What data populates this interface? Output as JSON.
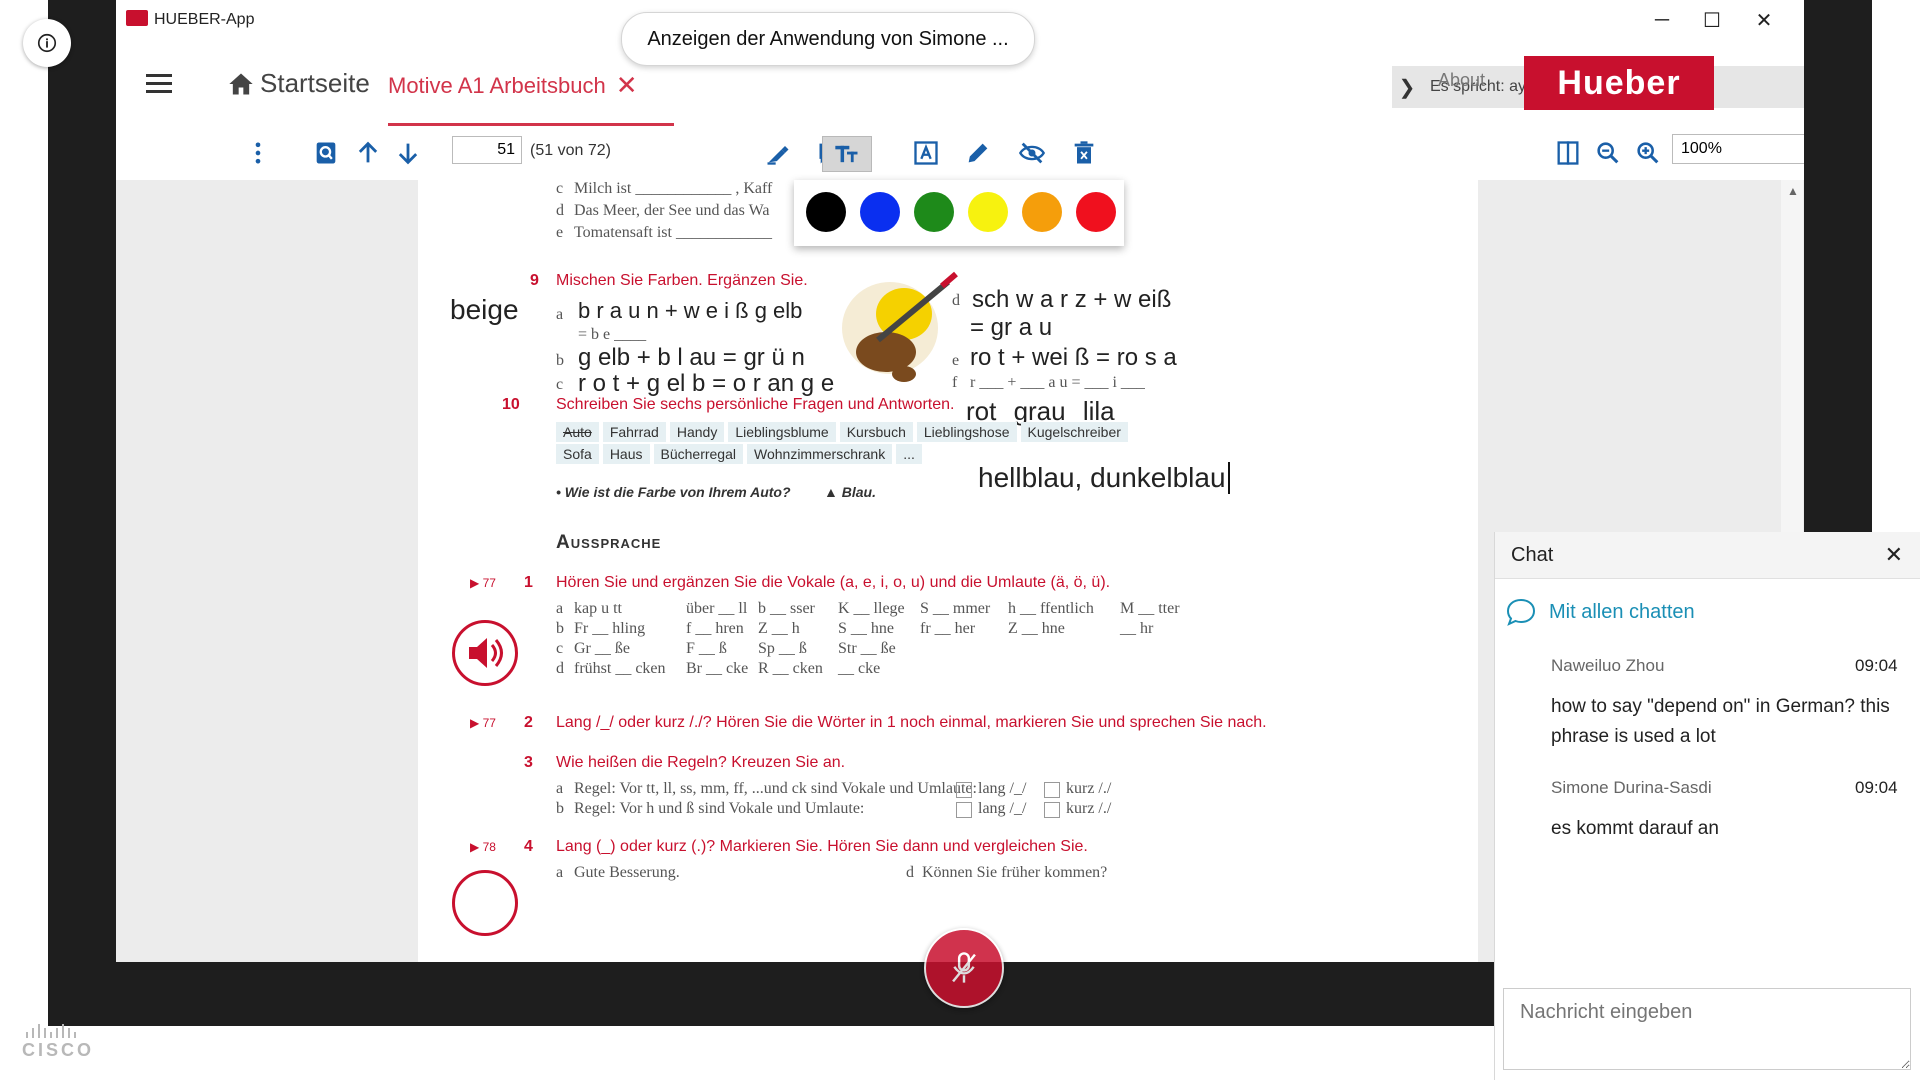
{
  "app": {
    "title": "HUEBER-App",
    "share_banner": "Anzeigen der Anwendung von Simone ..."
  },
  "window_controls": {
    "minimize": "─",
    "maximize": "☐",
    "close": "✕"
  },
  "nav": {
    "home_label": "Startseite",
    "book_tab": "Motive A1 Arbeitsbuch",
    "speaker_status": "Es spricht: ayse",
    "about": "About",
    "brand": "Hueber"
  },
  "toolbar": {
    "page_value": "51",
    "page_count": "(51 von 72)",
    "zoom_value": "100%"
  },
  "palette": {
    "colors": [
      "#000000",
      "#0a2ff0",
      "#1e8a1a",
      "#f7f20f",
      "#f59e0b",
      "#f0101e"
    ]
  },
  "doc": {
    "top_lines": [
      {
        "letter": "c",
        "text": "Milch ist ____________ , Kaff"
      },
      {
        "letter": "d",
        "text": "Das Meer, der See und das Wa"
      },
      {
        "letter": "e",
        "text": "Tomatensaft ist ____________"
      }
    ],
    "task9": {
      "num": "9",
      "title": "Mischen Sie Farben. Ergänzen Sie.",
      "beige": "beige",
      "a_letter": "a",
      "a_text": "b r a u n + w e i ß g elb",
      "a_result": "= b e ____",
      "b_letter": "b",
      "b_text": "g elb + b l au = gr ü n",
      "c_letter": "c",
      "c_text": "r o t + g el b = o r an g e",
      "d_letter": "d",
      "d_text": "sch w a r z + w eiß",
      "d_result": "= gr a u",
      "e_letter": "e",
      "e_text": "ro t + wei ß = ro s a",
      "f_letter": "f",
      "f_text": "r ___ + ___ a u = ___ i ___",
      "hw_colors": "rot  grau  lila"
    },
    "task10": {
      "num": "10",
      "title": "Schreiben Sie sechs persönliche Fragen und Antworten.",
      "chips_row1": [
        "Auto",
        "Fahrrad",
        "Handy",
        "Lieblingsblume",
        "Kursbuch",
        "Lieblingshose",
        "Kugelschreiber"
      ],
      "chips_row2": [
        "Sofa",
        "Haus",
        "Bücherregal",
        "Wohnzimmerschrank",
        "..."
      ],
      "question": "• Wie ist die Farbe von Ihrem Auto?",
      "answer": "▲ Blau.",
      "typed_answer": "hellblau, dunkelblau"
    },
    "section": "Aussprache",
    "task1": {
      "track": "▶ 77",
      "num": "1",
      "title": "Hören Sie und ergänzen Sie die Vokale (a, e, i, o, u) und die Umlaute (ä, ö, ü).",
      "rows": [
        [
          "a",
          "kap u tt",
          "über __ ll",
          "b __ sser",
          "K __ llege",
          "S __ mmer",
          "h __ ffentlich",
          "M __ tter"
        ],
        [
          "b",
          "Fr __ hling",
          "f __ hren",
          "Z __ h",
          "S __ hne",
          "fr __ her",
          "Z __ hne",
          "__ hr"
        ],
        [
          "c",
          "Gr __ ße",
          "F __ ß",
          "Sp __ ß",
          "Str __ ße",
          "",
          "",
          ""
        ],
        [
          "d",
          "frühst __ cken",
          "Br __ cke",
          "R __ cken",
          "__ cke",
          "",
          "",
          ""
        ]
      ]
    },
    "task2": {
      "track": "▶ 77",
      "num": "2",
      "title": "Lang /_/ oder kurz /./? Hören Sie die Wörter in 1 noch einmal, markieren Sie und sprechen Sie nach."
    },
    "task3": {
      "num": "3",
      "title": "Wie heißen die Regeln? Kreuzen Sie an.",
      "rows": [
        {
          "letter": "a",
          "text": "Regel: Vor tt, ll, ss, mm, ff, ...und ck sind Vokale und Umlaute:",
          "lang": "lang /_/",
          "kurz": "kurz /./"
        },
        {
          "letter": "b",
          "text": "Regel: Vor h und ß sind Vokale und Umlaute:",
          "lang": "lang /_/",
          "kurz": "kurz /./"
        }
      ]
    },
    "task4": {
      "track": "▶ 78",
      "num": "4",
      "title": "Lang (_) oder kurz (.)? Markieren Sie. Hören Sie dann und vergleichen Sie.",
      "a_letter": "a",
      "a_text": "Gute Besserung.",
      "d_letter": "d",
      "d_text": "Können Sie früher kommen?"
    }
  },
  "chat": {
    "title": "Chat",
    "close": "✕",
    "all_label": "Mit allen chatten",
    "messages": [
      {
        "name": "Naweiluo Zhou",
        "time": "09:04",
        "text": "how to say \"depend on\" in German? this phrase is used a lot"
      },
      {
        "name": "Simone Durina-Sasdi",
        "time": "09:04",
        "text": "es kommt darauf an"
      }
    ],
    "input_placeholder": "Nachricht eingeben"
  },
  "cisco": {
    "label": "CISCO"
  }
}
